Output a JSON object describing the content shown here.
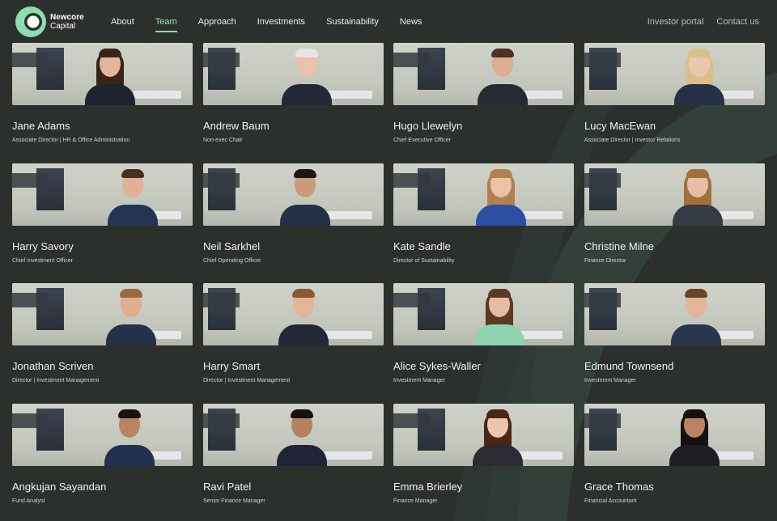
{
  "brand": {
    "line1": "Newcore",
    "line2": "Capital"
  },
  "nav": {
    "items": [
      {
        "label": "About"
      },
      {
        "label": "Team",
        "active": true
      },
      {
        "label": "Approach"
      },
      {
        "label": "Investments"
      },
      {
        "label": "Sustainability"
      },
      {
        "label": "News"
      }
    ]
  },
  "header_links": {
    "investor_portal": "Investor portal",
    "contact": "Contact us"
  },
  "colors": {
    "background": "#2b302d",
    "accent": "#8fdcae",
    "swoosh": "#34423a"
  },
  "team": [
    {
      "name": "Jane Adams",
      "role": "Associate Director | HR & Office Administration"
    },
    {
      "name": "Andrew Baum",
      "role": "Non-exec Chair"
    },
    {
      "name": "Hugo Llewelyn",
      "role": "Chief Executive Officer"
    },
    {
      "name": "Lucy MacEwan",
      "role": "Associate Director | Investor Relations"
    },
    {
      "name": "Harry Savory",
      "role": "Chief Investment Officer"
    },
    {
      "name": "Neil Sarkhel",
      "role": "Chief Operating Officer"
    },
    {
      "name": "Kate Sandle",
      "role": "Director of Sustainability"
    },
    {
      "name": "Christine Milne",
      "role": "Finance Director"
    },
    {
      "name": "Jonathan Scriven",
      "role": "Director | Investment Management"
    },
    {
      "name": "Harry Smart",
      "role": "Director | Investment Management"
    },
    {
      "name": "Alice Sykes-Waller",
      "role": "Investment Manager"
    },
    {
      "name": "Edmund Townsend",
      "role": "Investment Manager"
    },
    {
      "name": "Angkujan Sayandan",
      "role": "Fund Analyst"
    },
    {
      "name": "Ravi Patel",
      "role": "Senior Finance Manager"
    },
    {
      "name": "Emma Brierley",
      "role": "Finance Manager"
    },
    {
      "name": "Grace Thomas",
      "role": "Financial Accountant"
    }
  ]
}
